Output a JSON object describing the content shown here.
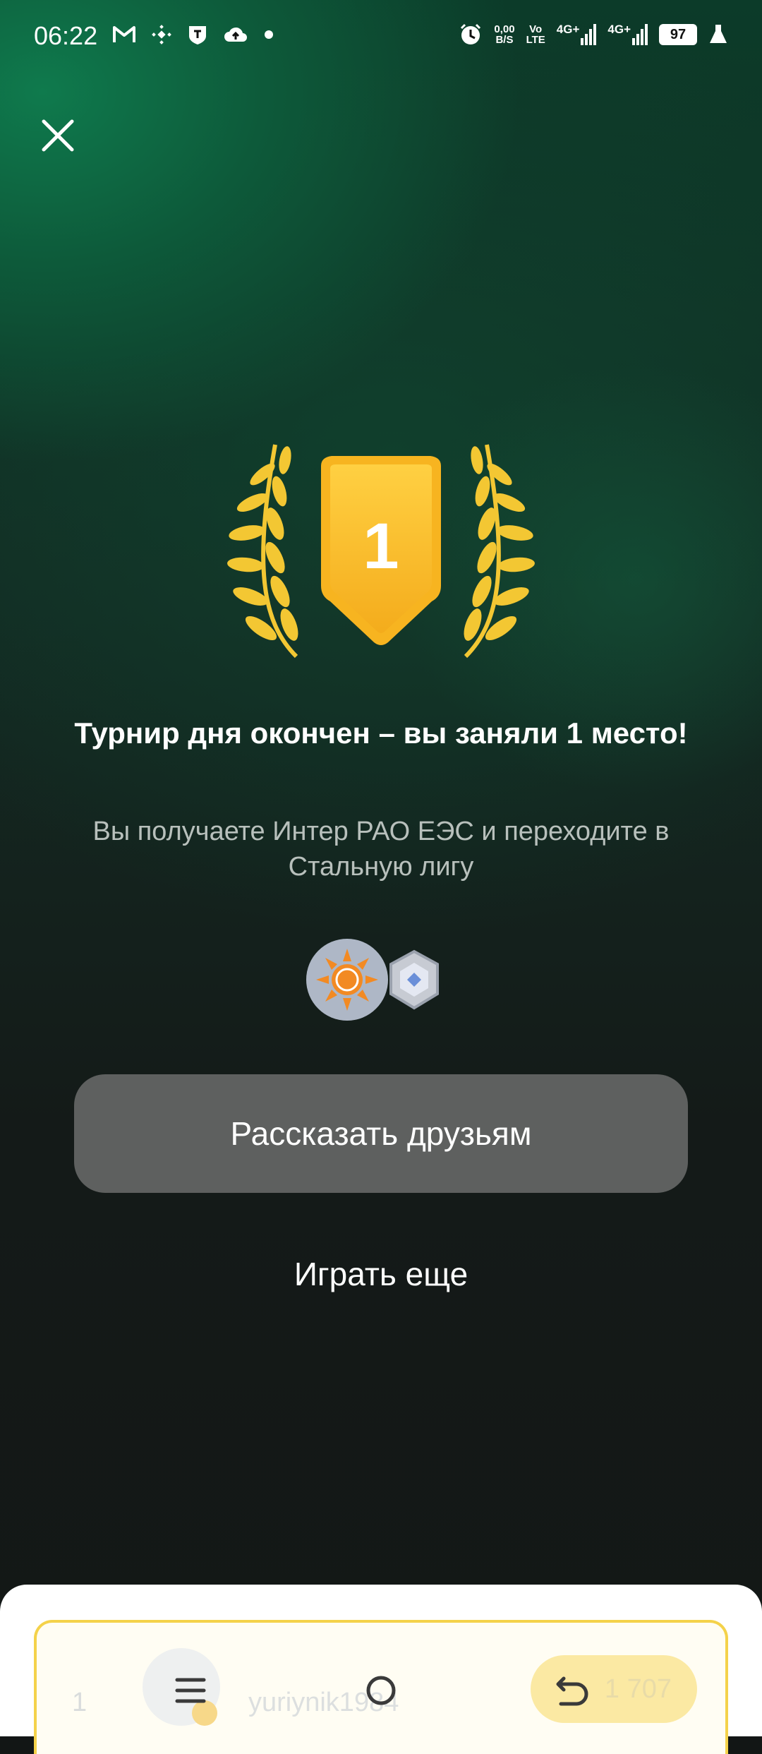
{
  "status_bar": {
    "time": "06:22",
    "net_speed_top": "0,00",
    "net_speed_bottom": "B/S",
    "volte_top": "Vo",
    "volte_bottom": "LTE",
    "signal1": "4G+",
    "signal2": "4G+",
    "battery": "97"
  },
  "trophy": {
    "place": "1"
  },
  "result": {
    "headline": "Турнир дня окончен – вы заняли 1 место!",
    "subline": "Вы получаете Интер РАО ЕЭС и переходите в Стальную лигу"
  },
  "actions": {
    "share_label": "Рассказать друзьям",
    "play_again_label": "Играть еще"
  },
  "leaderboard": {
    "rank": "1",
    "username": "yuriynik1984",
    "score": "1 707"
  },
  "colors": {
    "gold": "#f9c22e",
    "gold_dark": "#f0a818",
    "share_button_bg": "#5e605f",
    "leaderboard_border": "#f4d24a"
  }
}
